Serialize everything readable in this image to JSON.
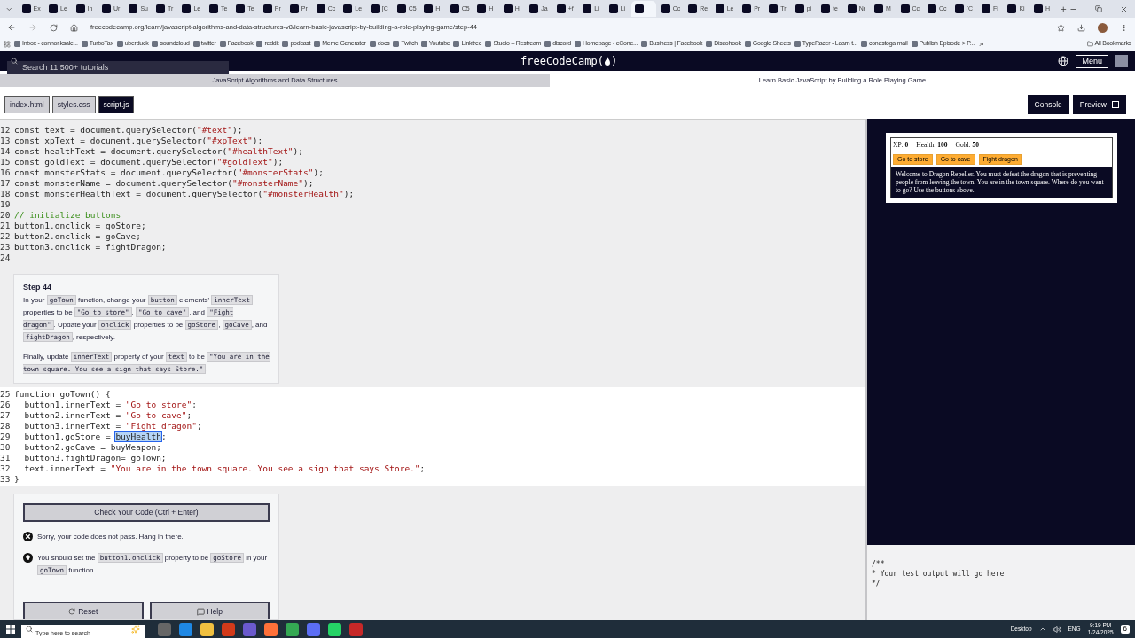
{
  "browser": {
    "tabs": [
      {
        "title": "Ex",
        "selected": false
      },
      {
        "title": "Le",
        "selected": false
      },
      {
        "title": "In",
        "selected": false
      },
      {
        "title": "Ur",
        "selected": false
      },
      {
        "title": "Su",
        "selected": false
      },
      {
        "title": "Tr",
        "selected": false
      },
      {
        "title": "Le",
        "selected": false
      },
      {
        "title": "Te",
        "selected": false
      },
      {
        "title": "Te",
        "selected": false
      },
      {
        "title": "Pr",
        "selected": false
      },
      {
        "title": "Pr",
        "selected": false
      },
      {
        "title": "Cc",
        "selected": false
      },
      {
        "title": "Le",
        "selected": false
      },
      {
        "title": "[C",
        "selected": false
      },
      {
        "title": "C5",
        "selected": false
      },
      {
        "title": "H",
        "selected": false
      },
      {
        "title": "C5",
        "selected": false
      },
      {
        "title": "H",
        "selected": false
      },
      {
        "title": "H",
        "selected": false
      },
      {
        "title": "Ja",
        "selected": false
      },
      {
        "title": "+f",
        "selected": false
      },
      {
        "title": "Li",
        "selected": false
      },
      {
        "title": "Li",
        "selected": false
      },
      {
        "selected": true
      },
      {
        "title": "Cc",
        "selected": false
      },
      {
        "title": "Re",
        "selected": false
      },
      {
        "title": "Le",
        "selected": false
      },
      {
        "title": "Pr",
        "selected": false
      },
      {
        "title": "Tr",
        "selected": false
      },
      {
        "title": "pi",
        "selected": false
      },
      {
        "title": "te",
        "selected": false
      },
      {
        "title": "Nr",
        "selected": false
      },
      {
        "title": "M",
        "selected": false
      },
      {
        "title": "Cc",
        "selected": false
      },
      {
        "title": "Cc",
        "selected": false
      },
      {
        "title": "(C",
        "selected": false
      },
      {
        "title": "Fi",
        "selected": false
      },
      {
        "title": "Ki",
        "selected": false
      },
      {
        "title": "H",
        "selected": false
      }
    ],
    "url": "freecodecamp.org/learn/javascript-algorithms-and-data-structures-v8/learn-basic-javascript-by-building-a-role-playing-game/step-44",
    "bookmarks": [
      "Inbox - connor.ksale...",
      "TurboTax",
      "uberduck",
      "soundcloud",
      "twitter",
      "Facebook",
      "reddit",
      "podcast",
      "Meme Generator",
      "docs",
      "Twitch",
      "Youtube",
      "Linktree",
      "Studio – Restream",
      "discord",
      "Homepage - eCone...",
      "Business | Facebook",
      "Discohook",
      "Google Sheets",
      "TypeRacer - Learn t...",
      "conestoga mail",
      "Publish Episode > P..."
    ],
    "all_bookmarks": "All Bookmarks"
  },
  "nav": {
    "search_placeholder": "Search 11,500+ tutorials",
    "logo": "freeCodeCamp(",
    "logo_end": ")",
    "menu": "Menu"
  },
  "breadcrumb": {
    "course": "JavaScript Algorithms and Data Structures",
    "project": "Learn Basic JavaScript by Building a Role Playing Game"
  },
  "file_tabs": [
    {
      "label": "index.html",
      "selected": false
    },
    {
      "label": "styles.css",
      "selected": false
    },
    {
      "label": "script.js",
      "selected": true
    }
  ],
  "panel_buttons": [
    "Console",
    "Preview"
  ],
  "code_top": [
    {
      "number": "12",
      "tokens": [
        {
          "text": "const text = document.querySelector(",
          "kind": "plain"
        },
        {
          "text": "\"#text\"",
          "kind": "string"
        },
        {
          "text": ");",
          "kind": "plain"
        }
      ]
    },
    {
      "number": "13",
      "tokens": [
        {
          "text": "const xpText = document.querySelector(",
          "kind": "plain"
        },
        {
          "text": "\"#xpText\"",
          "kind": "string"
        },
        {
          "text": ");",
          "kind": "plain"
        }
      ]
    },
    {
      "number": "14",
      "tokens": [
        {
          "text": "const healthText = document.querySelector(",
          "kind": "plain"
        },
        {
          "text": "\"#healthText\"",
          "kind": "string"
        },
        {
          "text": ");",
          "kind": "plain"
        }
      ]
    },
    {
      "number": "15",
      "tokens": [
        {
          "text": "const goldText = document.querySelector(",
          "kind": "plain"
        },
        {
          "text": "\"#goldText\"",
          "kind": "string"
        },
        {
          "text": ");",
          "kind": "plain"
        }
      ]
    },
    {
      "number": "16",
      "tokens": [
        {
          "text": "const monsterStats = document.querySelector(",
          "kind": "plain"
        },
        {
          "text": "\"#monsterStats\"",
          "kind": "string"
        },
        {
          "text": ");",
          "kind": "plain"
        }
      ]
    },
    {
      "number": "17",
      "tokens": [
        {
          "text": "const monsterName = document.querySelector(",
          "kind": "plain"
        },
        {
          "text": "\"#monsterName\"",
          "kind": "string"
        },
        {
          "text": ");",
          "kind": "plain"
        }
      ]
    },
    {
      "number": "18",
      "tokens": [
        {
          "text": "const monsterHealthText = document.querySelector(",
          "kind": "plain"
        },
        {
          "text": "\"#monsterHealth\"",
          "kind": "string"
        },
        {
          "text": ");",
          "kind": "plain"
        }
      ]
    },
    {
      "number": "19"
    },
    {
      "number": "20",
      "tokens": [
        {
          "text": "// initialize buttons",
          "kind": "comment"
        }
      ]
    },
    {
      "number": "21",
      "tokens": [
        {
          "text": "button1.onclick = goStore;",
          "kind": "plain"
        }
      ]
    },
    {
      "number": "22",
      "tokens": [
        {
          "text": "button2.onclick = goCave;",
          "kind": "plain"
        }
      ]
    },
    {
      "number": "23",
      "tokens": [
        {
          "text": "button3.onclick = fightDragon;",
          "kind": "plain"
        }
      ]
    },
    {
      "number": "24"
    }
  ],
  "step": {
    "title": "Step 44",
    "paragraphs": [
      [
        {
          "text": "In your ",
          "kind": "text"
        },
        {
          "text": "goTown",
          "kind": "code"
        },
        {
          "text": " function, change your ",
          "kind": "text"
        },
        {
          "text": "button",
          "kind": "code"
        },
        {
          "text": " elements' ",
          "kind": "text"
        },
        {
          "text": "innerText",
          "kind": "code"
        },
        {
          "text": " properties to be ",
          "kind": "text"
        },
        {
          "text": "\"Go to store\"",
          "kind": "code"
        },
        {
          "text": ", ",
          "kind": "text"
        },
        {
          "text": "\"Go to cave\"",
          "kind": "code"
        },
        {
          "text": ", and ",
          "kind": "text"
        },
        {
          "text": "\"Fight dragon\"",
          "kind": "code"
        },
        {
          "text": ". Update your ",
          "kind": "text"
        },
        {
          "text": "onclick",
          "kind": "code"
        },
        {
          "text": " properties to be ",
          "kind": "text"
        },
        {
          "text": "goStore",
          "kind": "code"
        },
        {
          "text": ", ",
          "kind": "text"
        },
        {
          "text": "goCave",
          "kind": "code"
        },
        {
          "text": ", and ",
          "kind": "text"
        },
        {
          "text": "fightDragon",
          "kind": "code"
        },
        {
          "text": ", respectively.",
          "kind": "text"
        }
      ],
      [
        {
          "text": "Finally, update ",
          "kind": "text"
        },
        {
          "text": "innerText",
          "kind": "code"
        },
        {
          "text": " property of your ",
          "kind": "text"
        },
        {
          "text": "text",
          "kind": "code"
        },
        {
          "text": " to be ",
          "kind": "text"
        },
        {
          "text": "\"You are in the town square. You see a sign that says Store.\"",
          "kind": "code"
        },
        {
          "text": ".",
          "kind": "text"
        }
      ]
    ]
  },
  "code_bottom": [
    {
      "number": "25",
      "tokens": [
        {
          "text": "function goTown() {",
          "kind": "plain"
        }
      ]
    },
    {
      "number": "26",
      "tokens": [
        {
          "text": "  button1.innerText = ",
          "kind": "plain"
        },
        {
          "text": "\"Go to store\"",
          "kind": "string"
        },
        {
          "text": ";",
          "kind": "plain"
        }
      ]
    },
    {
      "number": "27",
      "tokens": [
        {
          "text": "  button2.innerText = ",
          "kind": "plain"
        },
        {
          "text": "\"Go to cave\"",
          "kind": "string"
        },
        {
          "text": ";",
          "kind": "plain"
        }
      ]
    },
    {
      "number": "28",
      "tokens": [
        {
          "text": "  button3.innerText = ",
          "kind": "plain"
        },
        {
          "text": "\"Fight dragon\"",
          "kind": "string"
        },
        {
          "text": ";",
          "kind": "plain"
        }
      ]
    },
    {
      "number": "29",
      "tokens": [
        {
          "text": "  button1.goStore = ",
          "kind": "plain"
        },
        {
          "text": "buyHealth",
          "kind": "selected"
        },
        {
          "text": ";",
          "kind": "plain"
        }
      ]
    },
    {
      "number": "30",
      "tokens": [
        {
          "text": "  button2.goCave = buyWeapon;",
          "kind": "plain"
        }
      ]
    },
    {
      "number": "31",
      "tokens": [
        {
          "text": "  button3.fightDragon= goTown;",
          "kind": "plain"
        }
      ]
    },
    {
      "number": "32",
      "tokens": [
        {
          "text": "  text.innerText = ",
          "kind": "plain"
        },
        {
          "text": "\"You are in the town square. You see a sign that says Store.\"",
          "kind": "string"
        },
        {
          "text": ";",
          "kind": "plain"
        }
      ]
    },
    {
      "number": "33",
      "tokens": [
        {
          "text": "}",
          "kind": "plain"
        }
      ]
    }
  ],
  "check_button": "Check Your Code (Ctrl + Enter)",
  "feedback": [
    {
      "kind": "error",
      "segments": [
        {
          "text": "Sorry, your code does not pass. Hang in there.",
          "kind": "text"
        }
      ]
    },
    {
      "kind": "hint",
      "segments": [
        {
          "text": "You should set the ",
          "kind": "text"
        },
        {
          "text": "button1.onclick",
          "kind": "code"
        },
        {
          "text": " property to be ",
          "kind": "text"
        },
        {
          "text": "goStore",
          "kind": "code"
        },
        {
          "text": " in your ",
          "kind": "text"
        },
        {
          "text": "goTown",
          "kind": "code"
        },
        {
          "text": " function.",
          "kind": "text"
        }
      ]
    }
  ],
  "actions": [
    {
      "label": "Reset",
      "kind": "reset"
    },
    {
      "label": "Help",
      "kind": "help"
    }
  ],
  "preview": {
    "stats": [
      "XP: **0**",
      "Health: **100**",
      "Gold: **50**"
    ],
    "buttons": [
      "Go to store",
      "Go to cave",
      "Fight dragon"
    ],
    "text": "Welcome to Dragon Repeller. You must defeat the dragon that is preventing people from leaving the town. You are in the town square. Where do you want to go? Use the buttons above."
  },
  "console": [
    "/**",
    "* Your test output will go here",
    "*/"
  ],
  "taskbar": {
    "search_placeholder": "Type here to search",
    "desktop": "Desktop",
    "language": "ENG",
    "time": "9:19 PM",
    "date": "1/24/2025",
    "notifications": "6"
  }
}
